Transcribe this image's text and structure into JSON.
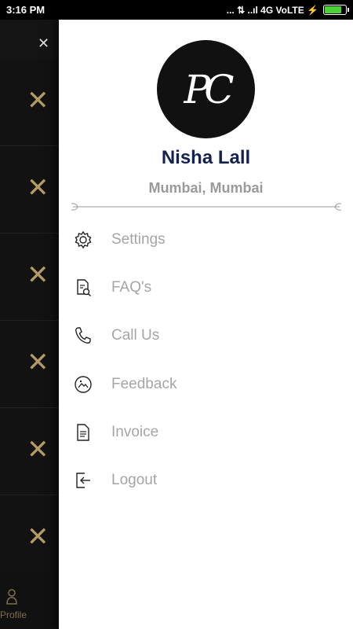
{
  "status_bar": {
    "time": "3:16 PM",
    "signal_text": "... ⇅ ..ıl 4G VoLTE ⚡"
  },
  "background": {
    "rows_count_icon": "close-icon",
    "profile_label": "Profile"
  },
  "drawer": {
    "avatar_initials": "PC",
    "user_name": "Nisha Lall",
    "user_location": "Mumbai, Mumbai",
    "menu": [
      {
        "label": "Settings",
        "icon": "gear-icon"
      },
      {
        "label": "FAQ's",
        "icon": "faq-document-icon"
      },
      {
        "label": "Call Us",
        "icon": "phone-icon"
      },
      {
        "label": "Feedback",
        "icon": "feedback-icon"
      },
      {
        "label": "Invoice",
        "icon": "invoice-icon"
      },
      {
        "label": "Logout",
        "icon": "logout-icon"
      }
    ]
  },
  "colors": {
    "name_color": "#13224f",
    "menu_text": "#a5a5a5",
    "accent_gold": "#b39b62"
  }
}
